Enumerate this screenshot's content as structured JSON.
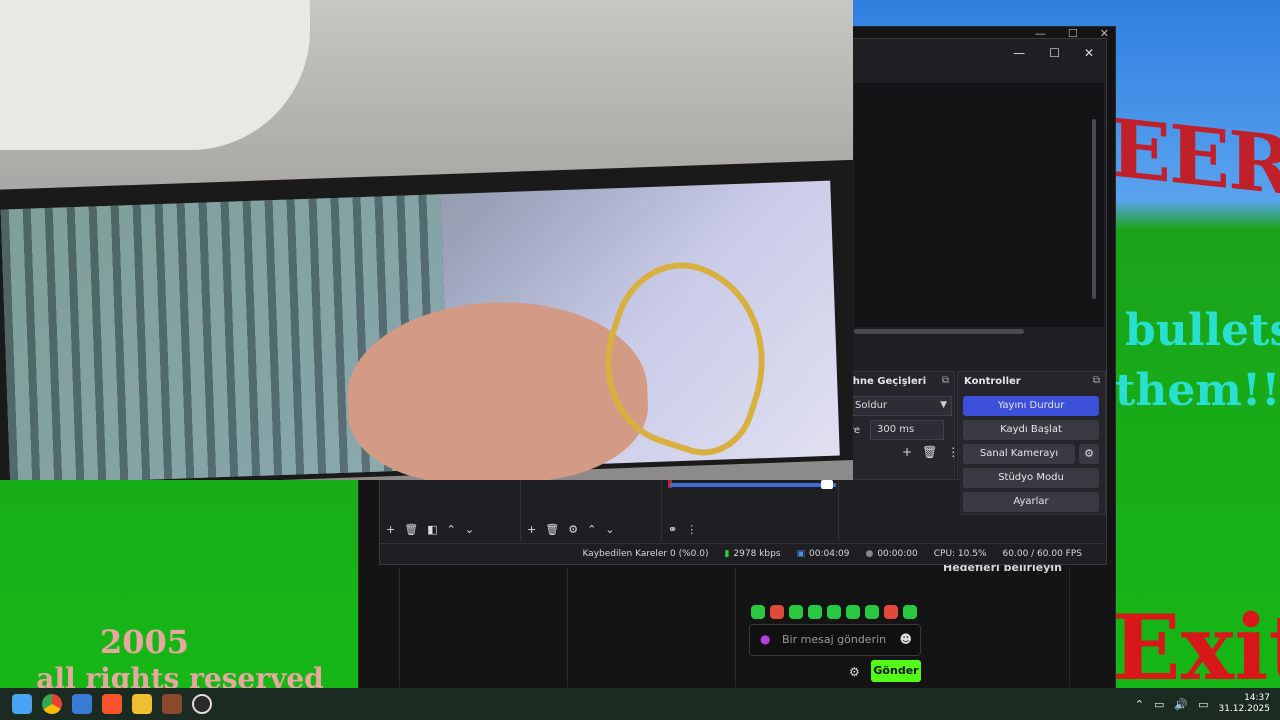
{
  "wallpaper": {
    "eer": "EER",
    "bullets": "bullets",
    "them": "them!!",
    "exit": "Exit",
    "year": "2005",
    "rights": "all rights reserved"
  },
  "back_window": {
    "goal_text": "Hedefleri belirleyin",
    "chat_placeholder": "Bir mesaj gönderin",
    "send_label": "Gönder"
  },
  "obs": {
    "transitions_title": "ahne Geçişleri",
    "transition_value": "Soldur",
    "duration_label": "re",
    "duration_value": "300 ms",
    "controls_title": "Kontroller",
    "controls": {
      "stop_stream": "Yayını Durdur",
      "start_record": "Kaydı Başlat",
      "start_vcam": "Sanal Kamerayı Başlat",
      "studio_mode": "Stüdyo Modu",
      "settings": "Ayarlar"
    },
    "status": {
      "dropped_frames": "Kaybedilen Kareler 0 (%0.0)",
      "bitrate": "2978 kbps",
      "stream_time": "00:04:09",
      "record_time": "00:00:00",
      "cpu": "CPU: 10.5%",
      "fps": "60.00 / 60.00 FPS"
    }
  },
  "taskbar": {
    "time": "14:37",
    "date": "31.12.2025"
  }
}
